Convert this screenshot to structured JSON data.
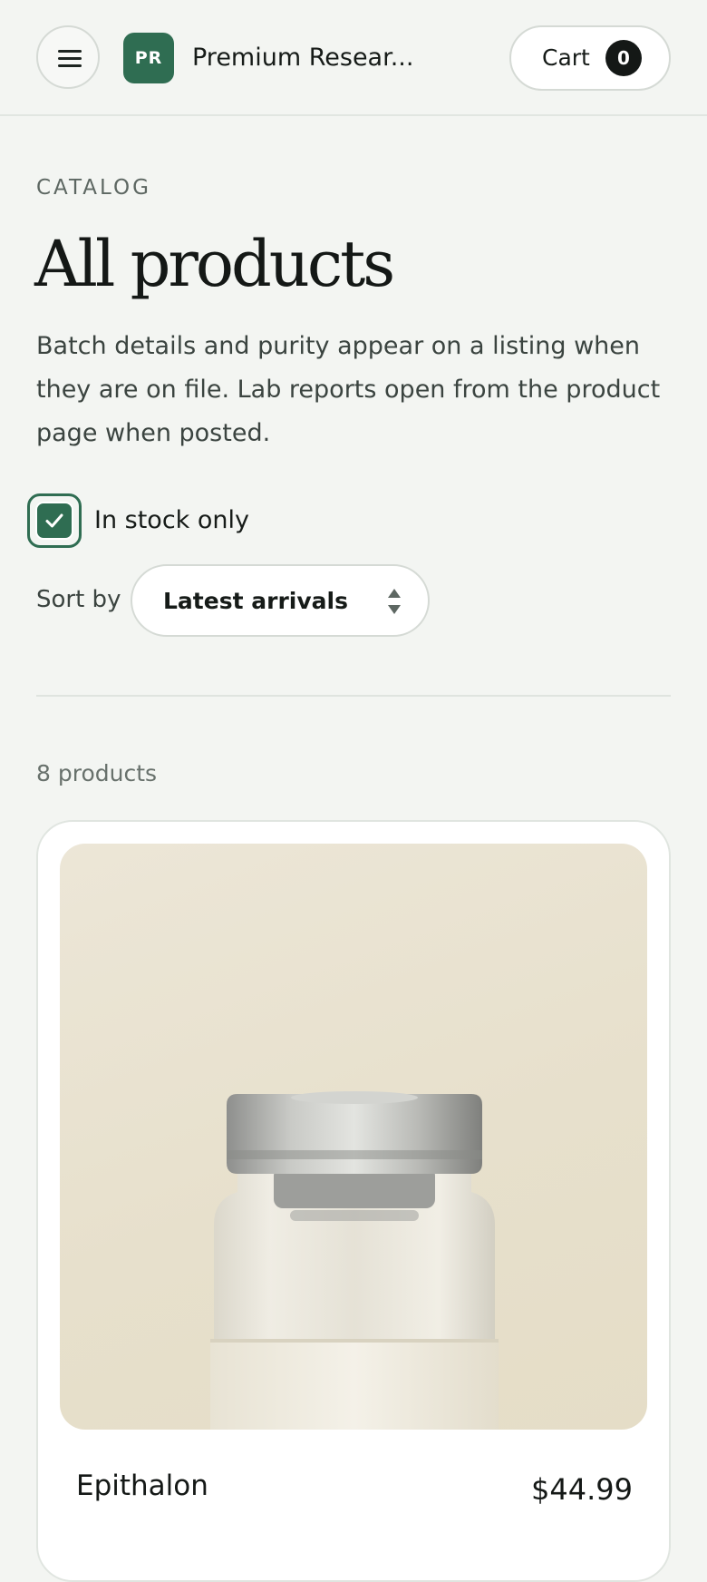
{
  "header": {
    "logo_initials": "PR",
    "brand_name": "Premium Resear...",
    "cart": {
      "label": "Cart",
      "count": "0"
    }
  },
  "catalog": {
    "eyebrow": "CATALOG",
    "title": "All products",
    "intro": "Batch details and purity appear on a listing when they are on file. Lab reports open from the product page when posted."
  },
  "filters": {
    "in_stock_label": "In stock only",
    "in_stock_checked": true,
    "sort_label": "Sort by",
    "sort_value": "Latest arrivals"
  },
  "results": {
    "count_text": "8 products"
  },
  "products": [
    {
      "name": "Epithalon",
      "price": "$44.99"
    }
  ],
  "colors": {
    "accent": "#2f6d52",
    "background": "#f3f5f2",
    "card": "#ffffff",
    "text": "#141816"
  }
}
